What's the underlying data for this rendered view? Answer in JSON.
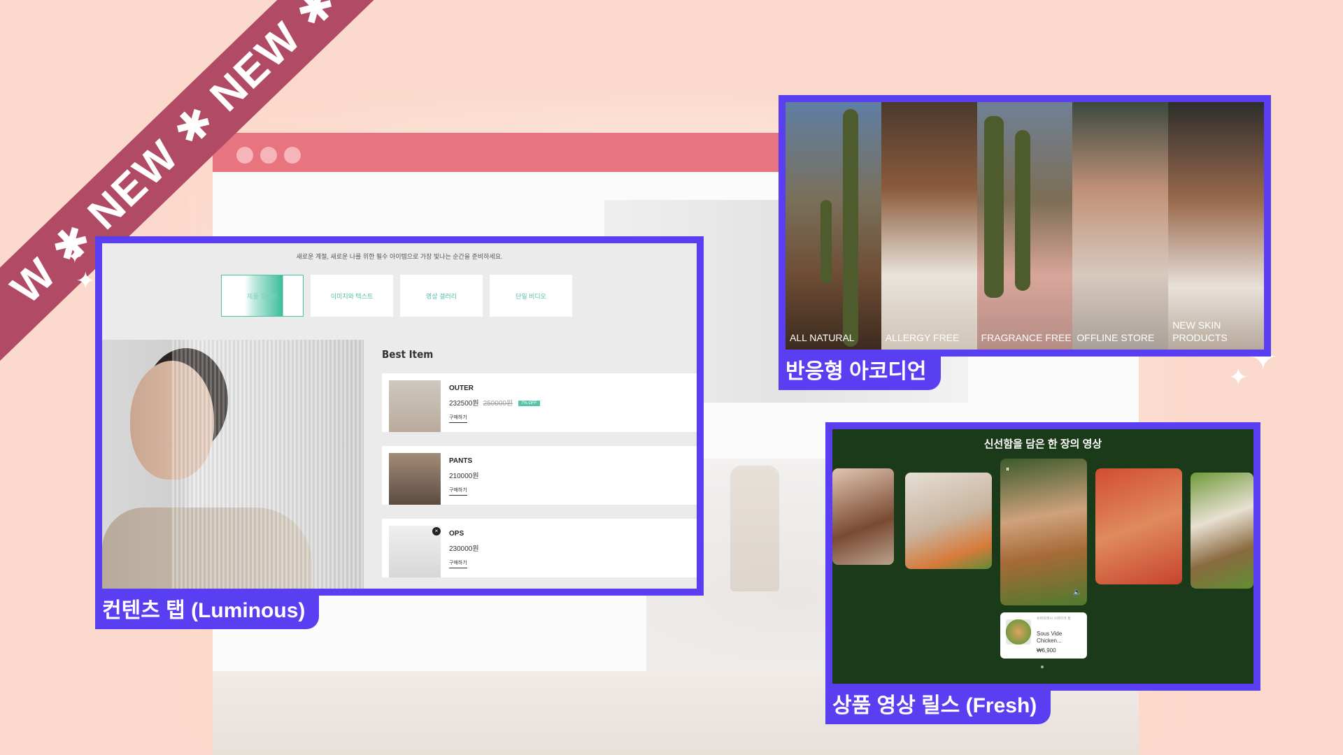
{
  "ribbon": {
    "text": "W ✱ NEW ✱ NEW ✱"
  },
  "luminous": {
    "label": "컨텐츠 탭 (Luminous)",
    "headline": "새로운 계절, 새로운 나를 위한 필수 아이템으로 가장 빛나는 순간을 준비하세요.",
    "tabs": [
      "제품 컬렉션",
      "이미지와 텍스트",
      "영상 갤러리",
      "단일 비디오"
    ],
    "best_title": "Best Item",
    "items": [
      {
        "name": "OUTER",
        "price": "232500원",
        "old_price": "250000원",
        "badge": "7% OFF",
        "buy": "구매하기"
      },
      {
        "name": "PANTS",
        "price": "210000원",
        "buy": "구매하기"
      },
      {
        "name": "OPS",
        "price": "230000원",
        "buy": "구매하기",
        "close": "×"
      }
    ]
  },
  "accordion": {
    "label": "반응형 아코디언",
    "columns": [
      "ALL NATURAL",
      "ALLERGY FREE",
      "FRAGRANCE FREE",
      "OFFLINE STORE",
      "NEW SKIN PRODUCTS"
    ]
  },
  "fresh": {
    "label": "상품 영상 릴스 (Fresh)",
    "title": "신선함을 담은 한 장의 영상",
    "card": {
      "brand": "슈퍼프레시 스테이크 정",
      "name": "Sous Vide Chicken...",
      "price": "₩6,900"
    },
    "pause_icon": "⏸",
    "mute_icon": "🔈"
  },
  "colors": {
    "accent": "#5a3ff2",
    "ribbon": "#b14a64",
    "browser_bar": "#e8747f",
    "fresh_bg": "#1a3a19",
    "tab": "#4fbfa8"
  }
}
